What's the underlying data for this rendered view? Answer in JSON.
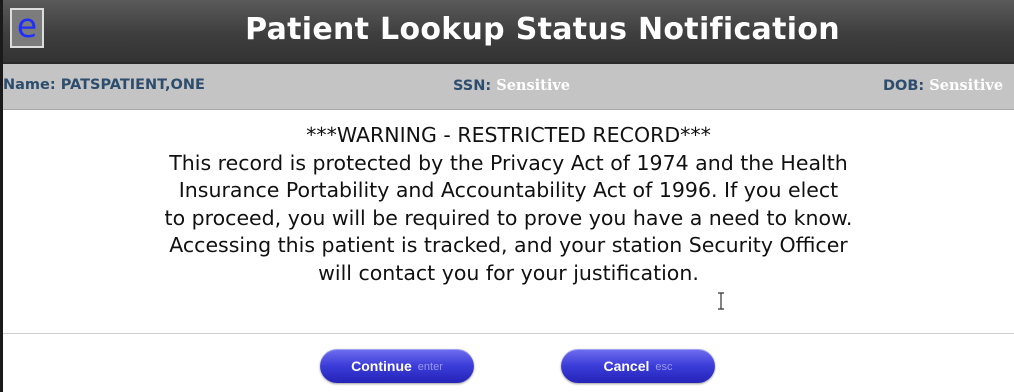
{
  "window": {
    "app_logo_letter": "e",
    "title": "Patient Lookup Status Notification"
  },
  "patient_info": {
    "name_label": "Name:",
    "name_value": "PATSPATIENT,ONE",
    "ssn_label": "SSN:",
    "ssn_value": "Sensitive",
    "dob_label": "DOB:",
    "dob_value": "Sensitive"
  },
  "message": {
    "line1": "***WARNING - RESTRICTED RECORD***",
    "line2": "This record is protected by the Privacy Act of 1974 and the Health",
    "line3": "Insurance Portability and Accountability Act of 1996. If you elect",
    "line4": "to proceed, you will be required to prove you have a need to know.",
    "line5": "Accessing this patient is tracked, and your station Security Officer",
    "line6": "will contact you for your justification."
  },
  "buttons": {
    "continue_label": "Continue",
    "continue_key": "enter",
    "cancel_label": "Cancel",
    "cancel_key": "esc"
  },
  "colors": {
    "titlebar": "#3e3e3e",
    "infobar": "#c4c4c4",
    "button": "#3b3bd8",
    "logo_letter": "#1f2eff"
  },
  "icons": {
    "app_logo": "app-logo-icon",
    "cursor": "text-cursor-icon"
  }
}
